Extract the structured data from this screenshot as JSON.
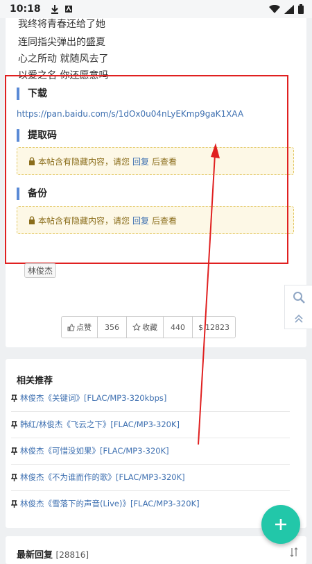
{
  "status_bar": {
    "time": "10:18"
  },
  "lyrics": [
    "我终将青春还给了她",
    "连同指尖弹出的盛夏",
    "心之所动 就随风去了",
    "以爱之名 你还愿意吗"
  ],
  "download": {
    "title": "下载",
    "link": "https://pan.baidu.com/s/1dOx0u04nLyEKmp9gaK1XAA"
  },
  "extract_code": {
    "title": "提取码",
    "hidden_prefix": "本帖含有隐藏内容，请您",
    "reply_label": "回复",
    "hidden_suffix": "后查看"
  },
  "backup": {
    "title": "备份",
    "hidden_prefix": "本帖含有隐藏内容，请您",
    "reply_label": "回复",
    "hidden_suffix": "后查看"
  },
  "tag": "林俊杰",
  "actions": {
    "like_label": "点赞",
    "like_count": "356",
    "fav_label": "收藏",
    "fav_count": "440",
    "coins": "12823"
  },
  "recommend": {
    "title": "相关推荐",
    "items": [
      "林俊杰《关键词》[FLAC/MP3-320kbps]",
      "韩红/林俊杰《飞云之下》[FLAC/MP3-320K]",
      "林俊杰《可惜没如果》[FLAC/MP3-320K]",
      "林俊杰《不为谁而作的歌》[FLAC/MP3-320K]",
      "林俊杰《雪落下的声音(Live)》[FLAC/MP3-320K]"
    ]
  },
  "latest_reply": {
    "title": "最新回复",
    "count": "[28816]"
  },
  "colors": {
    "accent_teal": "#22c7a9",
    "annotation_red": "#e02020",
    "link_blue": "#3d6fb0"
  }
}
